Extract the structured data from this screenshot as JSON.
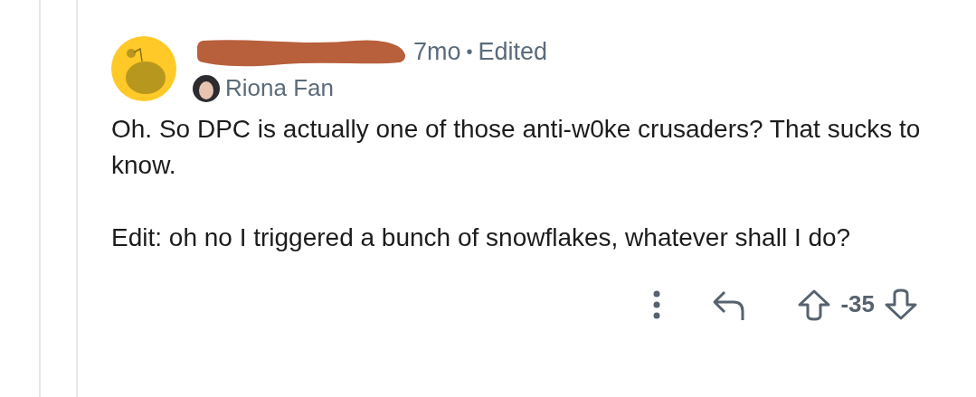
{
  "comment": {
    "age": "7mo",
    "separator": "•",
    "edited_label": "Edited",
    "flair": "Riona Fan",
    "paragraphs": [
      "Oh. So DPC is actually one of those anti-w0ke crusaders? That sucks to know.",
      "Edit: oh no I triggered a bunch of snowflakes, whatever shall I do?"
    ],
    "score": "-35"
  }
}
